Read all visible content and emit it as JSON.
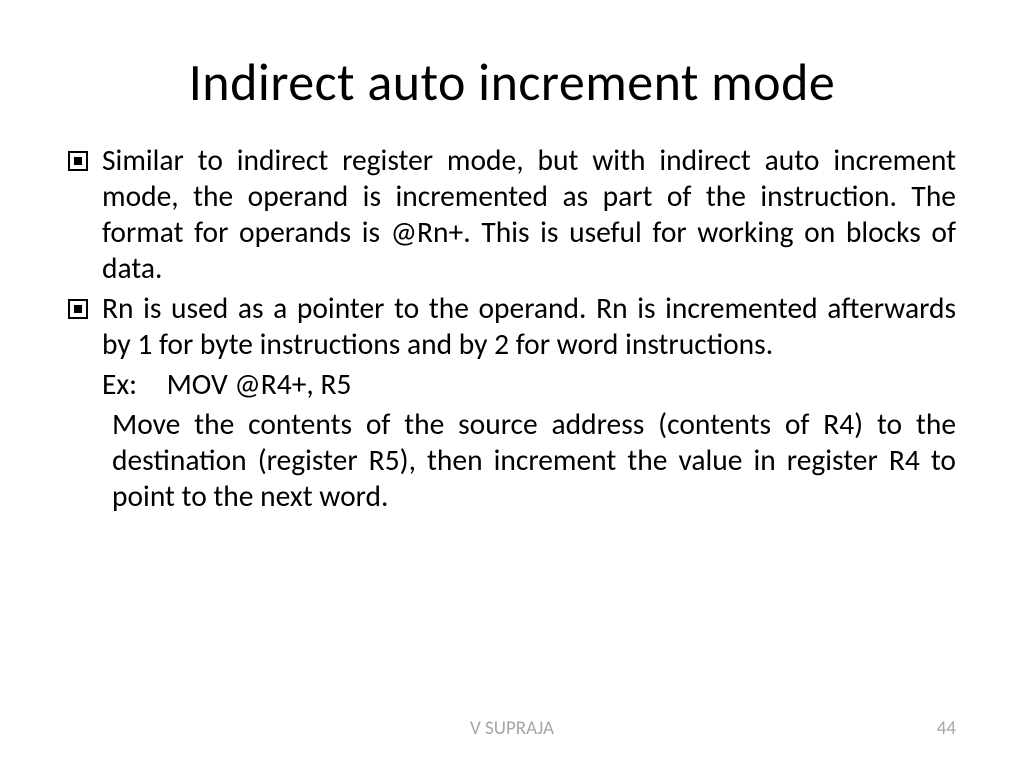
{
  "title": "Indirect auto increment mode",
  "bullets": [
    "Similar to indirect register mode, but with indirect auto increment mode, the operand is incremented as part of the instruction. The format for operands is @Rn+. This is useful for working on blocks of data.",
    "Rn is used as a pointer to the operand. Rn is incremented afterwards by 1 for byte instructions and by 2 for word instructions."
  ],
  "example_label": "Ex: MOV @R4+, R5",
  "example_desc": "Move the contents of the source address (contents of R4) to the destination (register R5), then increment the value in register R4 to point to the next word.",
  "footer_author": "V SUPRAJA",
  "page_number": "44"
}
